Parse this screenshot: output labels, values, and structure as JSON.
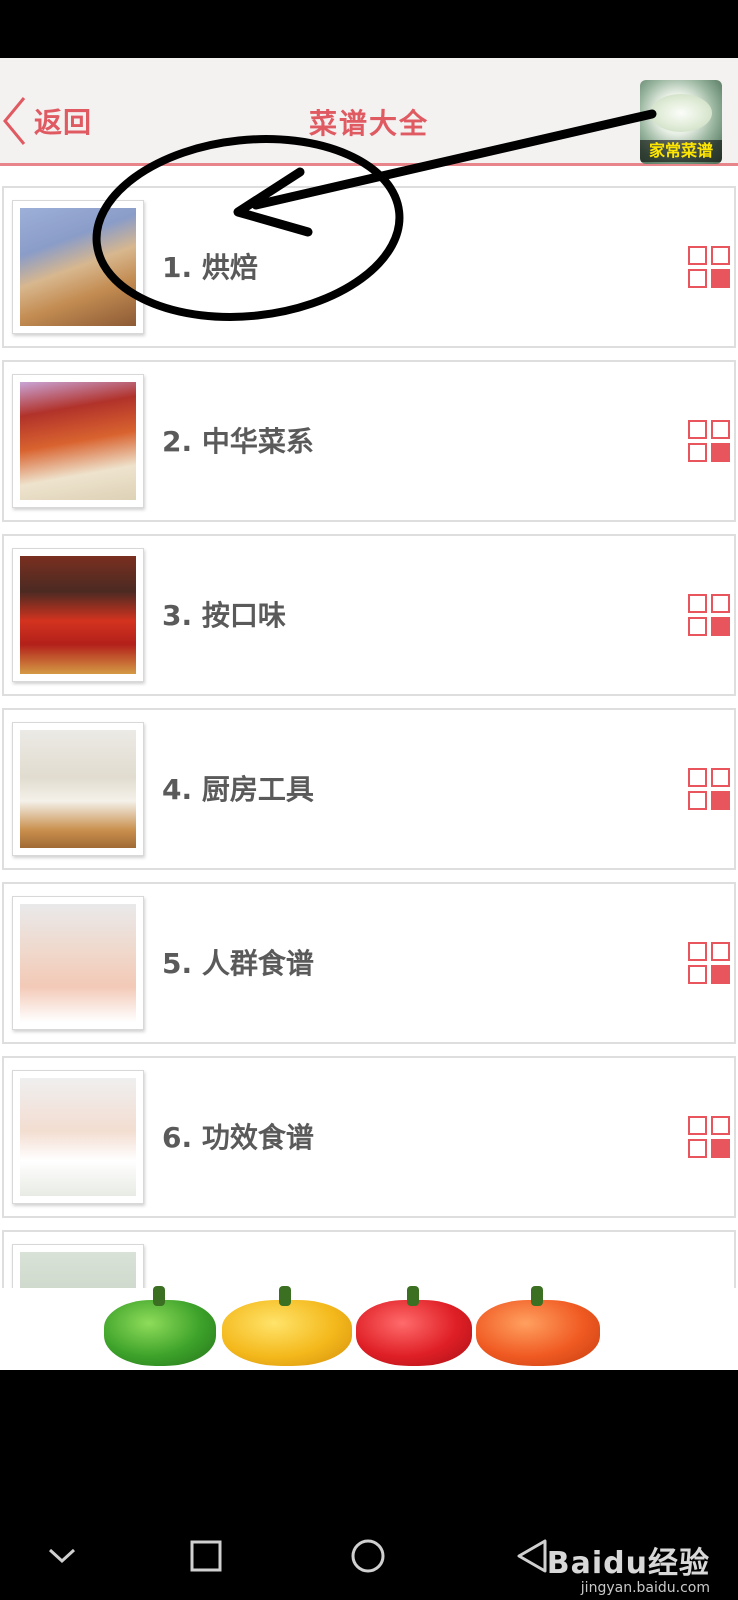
{
  "header": {
    "back_label": "返回",
    "title": "菜谱大全",
    "badge_text": "家常菜谱"
  },
  "categories": [
    {
      "label": "1. 烘焙",
      "image": "baking-photo"
    },
    {
      "label": "2. 中华菜系",
      "image": "chinese-cuisine-photo"
    },
    {
      "label": "3. 按口味",
      "image": "chili-photo"
    },
    {
      "label": "4. 厨房工具",
      "image": "kitchen-photo"
    },
    {
      "label": "5. 人群食谱",
      "image": "pregnancy-photo"
    },
    {
      "label": "6. 功效食谱",
      "image": "fitness-photo"
    }
  ],
  "icons": {
    "back": "chevron-left-icon",
    "category_menu": "grid-icon",
    "nav_down": "chevron-down-icon",
    "nav_recent": "square-icon",
    "nav_home": "circle-icon",
    "nav_back": "triangle-back-icon"
  },
  "watermark": {
    "brand": "Baidu经验",
    "site": "jingyan.baidu.com"
  },
  "colors": {
    "accent": "#e05a62",
    "grid_icon": "#e8555c",
    "header_bg": "#f4f1f1"
  }
}
